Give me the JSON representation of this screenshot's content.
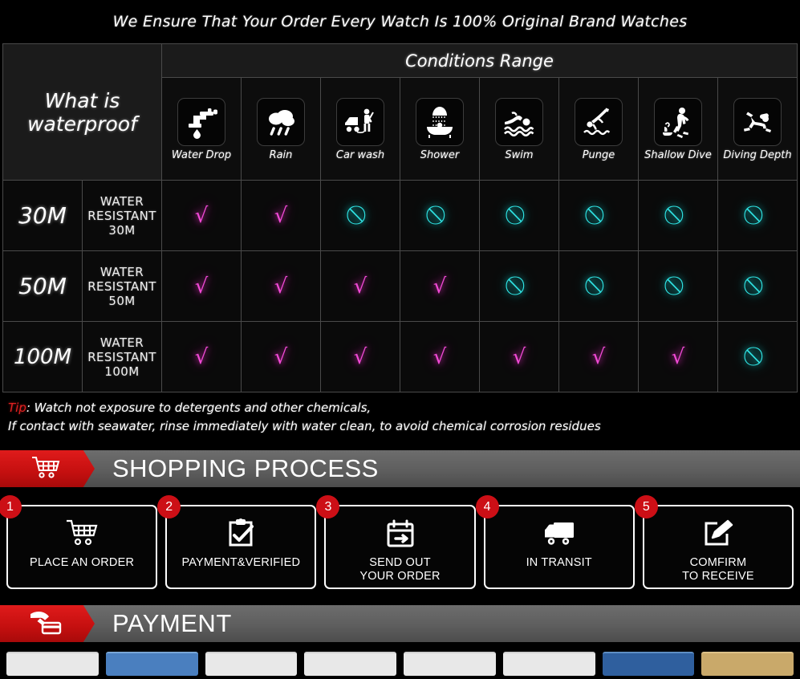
{
  "headline": "We Ensure That Your Order Every Watch Is 100% Original Brand Watches",
  "waterproof_table": {
    "title": "What is waterproof",
    "conditions_header": "Conditions Range",
    "columns": [
      {
        "label": "Water Drop",
        "icon": "faucet-drip-icon"
      },
      {
        "label": "Rain",
        "icon": "rain-cloud-icon"
      },
      {
        "label": "Car wash",
        "icon": "car-wash-icon"
      },
      {
        "label": "Shower",
        "icon": "shower-bath-icon"
      },
      {
        "label": "Swim",
        "icon": "swimmer-icon"
      },
      {
        "label": "Punge",
        "icon": "plunge-dive-icon"
      },
      {
        "label": "Shallow Dive",
        "icon": "shallow-dive-icon"
      },
      {
        "label": "Diving Depth",
        "icon": "scuba-diver-icon"
      }
    ],
    "rows": [
      {
        "depth": "30M",
        "description": "WATER RESISTANT  30M",
        "marks": [
          "yes",
          "yes",
          "no",
          "no",
          "no",
          "no",
          "no",
          "no"
        ]
      },
      {
        "depth": "50M",
        "description": "WATER RESISTANT 50M",
        "marks": [
          "yes",
          "yes",
          "yes",
          "yes",
          "no",
          "no",
          "no",
          "no"
        ]
      },
      {
        "depth": "100M",
        "description": "WATER RESISTANT  100M",
        "marks": [
          "yes",
          "yes",
          "yes",
          "yes",
          "yes",
          "yes",
          "yes",
          "no"
        ]
      }
    ],
    "mark_glyphs": {
      "yes": "√",
      "no": "⃠"
    },
    "mark_colors": {
      "yes": "#f14ad6",
      "no": "#2fe4e4"
    }
  },
  "tip": {
    "label": "Tip",
    "line1": ": Watch not exposure to detergents and other chemicals,",
    "line2": "If contact with seawater, rinse immediately with water clean, to avoid chemical corrosion residues",
    "label_color": "#e02020"
  },
  "shopping_process": {
    "banner_title": "SHOPPING PROCESS",
    "banner_icon": "shopping-cart-icon",
    "banner_accent": "#cc0f0f",
    "steps": [
      {
        "number": "1",
        "label": "PLACE AN ORDER",
        "icon": "shopping-cart-icon"
      },
      {
        "number": "2",
        "label": "PAYMENT&VERIFIED",
        "icon": "clipboard-check-icon"
      },
      {
        "number": "3",
        "label": "SEND OUT\nYOUR ORDER",
        "icon": "calendar-arrow-icon"
      },
      {
        "number": "4",
        "label": "IN TRANSIT",
        "icon": "delivery-truck-icon"
      },
      {
        "number": "5",
        "label": "COMFIRM\nTO RECEIVE",
        "icon": "edit-pencil-icon"
      }
    ]
  },
  "payment": {
    "banner_title": "PAYMENT",
    "banner_icon": "hand-card-icon",
    "banner_accent": "#cc0f0f"
  }
}
